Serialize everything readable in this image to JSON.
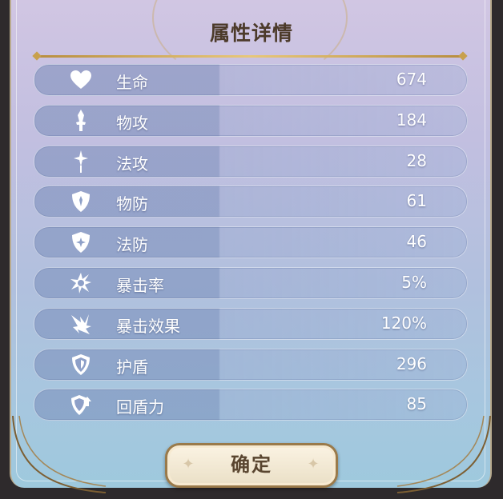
{
  "panel": {
    "title": "属性详情"
  },
  "stats": [
    {
      "icon": "heart-icon",
      "label": "生命",
      "value": "674"
    },
    {
      "icon": "sword-icon",
      "label": "物攻",
      "value": "184"
    },
    {
      "icon": "magic-star-icon",
      "label": "法攻",
      "value": "28"
    },
    {
      "icon": "shield-icon",
      "label": "物防",
      "value": "61"
    },
    {
      "icon": "magic-shield-icon",
      "label": "法防",
      "value": "46"
    },
    {
      "icon": "critical-burst-icon",
      "label": "暴击率",
      "value": "5%"
    },
    {
      "icon": "critical-damage-icon",
      "label": "暴击效果",
      "value": "120%"
    },
    {
      "icon": "barrier-shield-icon",
      "label": "护盾",
      "value": "296"
    },
    {
      "icon": "shield-regen-icon",
      "label": "回盾力",
      "value": "85"
    }
  ],
  "buttons": {
    "confirm_label": "确定"
  }
}
